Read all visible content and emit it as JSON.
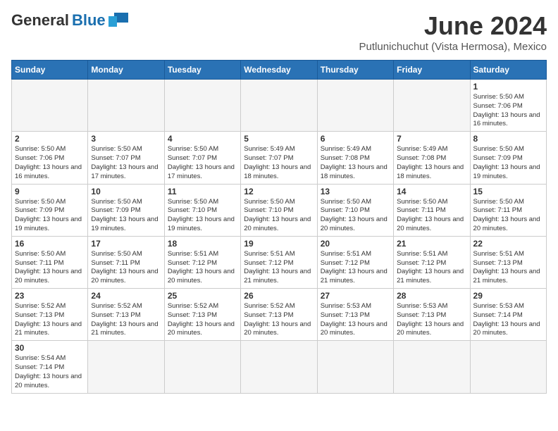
{
  "logo": {
    "general": "General",
    "blue": "Blue"
  },
  "header": {
    "month_year": "June 2024",
    "location": "Putlunichuchut (Vista Hermosa), Mexico"
  },
  "weekdays": [
    "Sunday",
    "Monday",
    "Tuesday",
    "Wednesday",
    "Thursday",
    "Friday",
    "Saturday"
  ],
  "weeks": [
    [
      {
        "day": null,
        "info": null
      },
      {
        "day": null,
        "info": null
      },
      {
        "day": null,
        "info": null
      },
      {
        "day": null,
        "info": null
      },
      {
        "day": null,
        "info": null
      },
      {
        "day": null,
        "info": null
      },
      {
        "day": "1",
        "info": "Sunrise: 5:50 AM\nSunset: 7:06 PM\nDaylight: 13 hours and 16 minutes."
      }
    ],
    [
      {
        "day": "2",
        "info": "Sunrise: 5:50 AM\nSunset: 7:06 PM\nDaylight: 13 hours and 16 minutes."
      },
      {
        "day": "3",
        "info": "Sunrise: 5:50 AM\nSunset: 7:07 PM\nDaylight: 13 hours and 17 minutes."
      },
      {
        "day": "4",
        "info": "Sunrise: 5:50 AM\nSunset: 7:07 PM\nDaylight: 13 hours and 17 minutes."
      },
      {
        "day": "5",
        "info": "Sunrise: 5:49 AM\nSunset: 7:07 PM\nDaylight: 13 hours and 18 minutes."
      },
      {
        "day": "6",
        "info": "Sunrise: 5:49 AM\nSunset: 7:08 PM\nDaylight: 13 hours and 18 minutes."
      },
      {
        "day": "7",
        "info": "Sunrise: 5:49 AM\nSunset: 7:08 PM\nDaylight: 13 hours and 18 minutes."
      },
      {
        "day": "8",
        "info": "Sunrise: 5:50 AM\nSunset: 7:09 PM\nDaylight: 13 hours and 19 minutes."
      }
    ],
    [
      {
        "day": "9",
        "info": "Sunrise: 5:50 AM\nSunset: 7:09 PM\nDaylight: 13 hours and 19 minutes."
      },
      {
        "day": "10",
        "info": "Sunrise: 5:50 AM\nSunset: 7:09 PM\nDaylight: 13 hours and 19 minutes."
      },
      {
        "day": "11",
        "info": "Sunrise: 5:50 AM\nSunset: 7:10 PM\nDaylight: 13 hours and 19 minutes."
      },
      {
        "day": "12",
        "info": "Sunrise: 5:50 AM\nSunset: 7:10 PM\nDaylight: 13 hours and 20 minutes."
      },
      {
        "day": "13",
        "info": "Sunrise: 5:50 AM\nSunset: 7:10 PM\nDaylight: 13 hours and 20 minutes."
      },
      {
        "day": "14",
        "info": "Sunrise: 5:50 AM\nSunset: 7:11 PM\nDaylight: 13 hours and 20 minutes."
      },
      {
        "day": "15",
        "info": "Sunrise: 5:50 AM\nSunset: 7:11 PM\nDaylight: 13 hours and 20 minutes."
      }
    ],
    [
      {
        "day": "16",
        "info": "Sunrise: 5:50 AM\nSunset: 7:11 PM\nDaylight: 13 hours and 20 minutes."
      },
      {
        "day": "17",
        "info": "Sunrise: 5:50 AM\nSunset: 7:11 PM\nDaylight: 13 hours and 20 minutes."
      },
      {
        "day": "18",
        "info": "Sunrise: 5:51 AM\nSunset: 7:12 PM\nDaylight: 13 hours and 20 minutes."
      },
      {
        "day": "19",
        "info": "Sunrise: 5:51 AM\nSunset: 7:12 PM\nDaylight: 13 hours and 21 minutes."
      },
      {
        "day": "20",
        "info": "Sunrise: 5:51 AM\nSunset: 7:12 PM\nDaylight: 13 hours and 21 minutes."
      },
      {
        "day": "21",
        "info": "Sunrise: 5:51 AM\nSunset: 7:12 PM\nDaylight: 13 hours and 21 minutes."
      },
      {
        "day": "22",
        "info": "Sunrise: 5:51 AM\nSunset: 7:13 PM\nDaylight: 13 hours and 21 minutes."
      }
    ],
    [
      {
        "day": "23",
        "info": "Sunrise: 5:52 AM\nSunset: 7:13 PM\nDaylight: 13 hours and 21 minutes."
      },
      {
        "day": "24",
        "info": "Sunrise: 5:52 AM\nSunset: 7:13 PM\nDaylight: 13 hours and 21 minutes."
      },
      {
        "day": "25",
        "info": "Sunrise: 5:52 AM\nSunset: 7:13 PM\nDaylight: 13 hours and 20 minutes."
      },
      {
        "day": "26",
        "info": "Sunrise: 5:52 AM\nSunset: 7:13 PM\nDaylight: 13 hours and 20 minutes."
      },
      {
        "day": "27",
        "info": "Sunrise: 5:53 AM\nSunset: 7:13 PM\nDaylight: 13 hours and 20 minutes."
      },
      {
        "day": "28",
        "info": "Sunrise: 5:53 AM\nSunset: 7:13 PM\nDaylight: 13 hours and 20 minutes."
      },
      {
        "day": "29",
        "info": "Sunrise: 5:53 AM\nSunset: 7:14 PM\nDaylight: 13 hours and 20 minutes."
      }
    ],
    [
      {
        "day": "30",
        "info": "Sunrise: 5:54 AM\nSunset: 7:14 PM\nDaylight: 13 hours and 20 minutes."
      },
      {
        "day": null,
        "info": null
      },
      {
        "day": null,
        "info": null
      },
      {
        "day": null,
        "info": null
      },
      {
        "day": null,
        "info": null
      },
      {
        "day": null,
        "info": null
      },
      {
        "day": null,
        "info": null
      }
    ]
  ]
}
